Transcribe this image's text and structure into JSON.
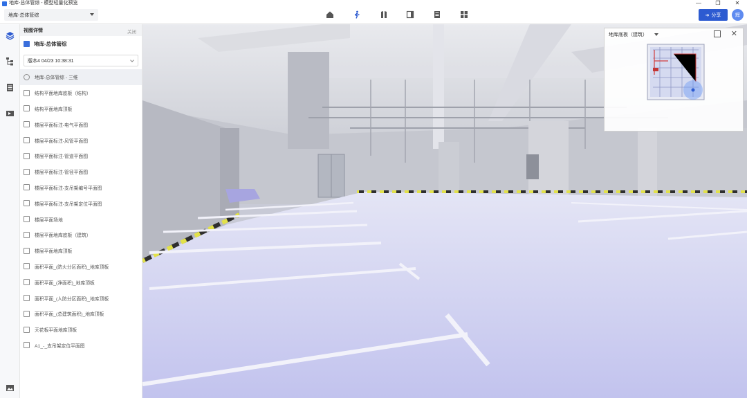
{
  "window": {
    "title": "地库-总体管综 - 模型轻量化预览",
    "minimize_glyph": "—",
    "restore_glyph": "❐",
    "close_glyph": "✕"
  },
  "toolbar": {
    "project_select": "地库-总体管综",
    "modes": [
      {
        "name": "home-mode-icon",
        "glyph": "⌂"
      },
      {
        "name": "walk-mode-icon",
        "glyph": "🚶"
      },
      {
        "name": "section-mode-icon",
        "glyph": "▥"
      },
      {
        "name": "compare-mode-icon",
        "glyph": "◫"
      },
      {
        "name": "document-mode-icon",
        "glyph": "▤"
      },
      {
        "name": "grid-mode-icon",
        "glyph": "▦"
      }
    ],
    "share_label": "分享",
    "share_glyph": "➜",
    "avatar_text": "辉"
  },
  "panel": {
    "title": "视图详情",
    "close_label": "关闭",
    "model_name": "地库-总体管综",
    "version": "版本4 04/23 10:38:31",
    "items": [
      {
        "label": "地库-总体管综 - 三维",
        "icon": "globe",
        "active": true
      },
      {
        "label": "结构平面地库底板（结构）",
        "icon": "plan",
        "active": false
      },
      {
        "label": "结构平面地库顶板",
        "icon": "plan",
        "active": false
      },
      {
        "label": "楼层平面标注-电气平面图",
        "icon": "plan",
        "active": false
      },
      {
        "label": "楼层平面标注-风管平面图",
        "icon": "plan",
        "active": false
      },
      {
        "label": "楼层平面标注-管道平面图",
        "icon": "plan",
        "active": false
      },
      {
        "label": "楼层平面标注-管径平面图",
        "icon": "plan",
        "active": false
      },
      {
        "label": "楼层平面标注-支吊架编号平面图",
        "icon": "plan",
        "active": false
      },
      {
        "label": "楼层平面标注-支吊架定位平面图",
        "icon": "plan",
        "active": false
      },
      {
        "label": "楼层平面场地",
        "icon": "plan",
        "active": false
      },
      {
        "label": "楼层平面地库底板（建筑）",
        "icon": "plan",
        "active": false
      },
      {
        "label": "楼层平面地库顶板",
        "icon": "plan",
        "active": false
      },
      {
        "label": "面积平面_(防火分区面积)_地库顶板",
        "icon": "plan",
        "active": false
      },
      {
        "label": "面积平面_(净面积)_地库顶板",
        "icon": "plan",
        "active": false
      },
      {
        "label": "面积平面_(人防分区面积)_地库顶板",
        "icon": "plan",
        "active": false
      },
      {
        "label": "面积平面_(总建筑面积)_地库顶板",
        "icon": "plan",
        "active": false
      },
      {
        "label": "天花板平面地库顶板",
        "icon": "plan",
        "active": false
      },
      {
        "label": "A1_-_支吊架定位平面图",
        "icon": "sheet",
        "active": false
      }
    ]
  },
  "minimap": {
    "select": "地库底板（建筑）"
  },
  "colors": {
    "accent": "#2d5bd1",
    "floor": "#d6d7f2",
    "wall": "#c7c9d2"
  }
}
